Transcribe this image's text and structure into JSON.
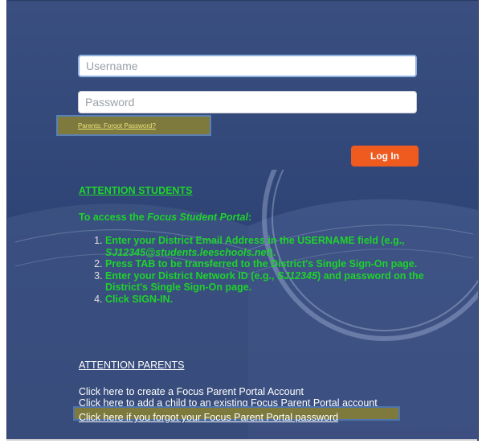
{
  "login": {
    "username_placeholder": "Username",
    "password_placeholder": "Password",
    "forgot_password_link": "Parents: Forgot Password?",
    "login_button": "Log In"
  },
  "students": {
    "heading": "ATTENTION STUDENTS",
    "intro_prefix": "To access the ",
    "intro_portal": "Focus Student Portal",
    "intro_suffix": ":",
    "step1_a": "Enter your District Email Address in the USERNAME field (e.g., ",
    "step1_example": "SJ12345@students.leeschools.net",
    "step1_b": ").",
    "step2": "Press TAB to be transferred to the District's Single Sign-On page.",
    "step3_a": "Enter your District Network ID (e.g., ",
    "step3_example": "SJ12345",
    "step3_b": ") and password on the District's Single Sign-On page.",
    "step4": "Click SIGN-IN."
  },
  "parents": {
    "heading": "ATTENTION PARENTS",
    "link_create": "Click here to create a Focus Parent Portal Account",
    "link_add_child": "Click here to add a child to an existing Focus Parent Portal account",
    "link_forgot": "Click here if you forgot your Focus Parent Portal password"
  },
  "colors": {
    "background": "#2e4375",
    "accent_button": "#ef5a1f",
    "student_text": "#1ed32b",
    "highlight": "#7e7a3d"
  }
}
